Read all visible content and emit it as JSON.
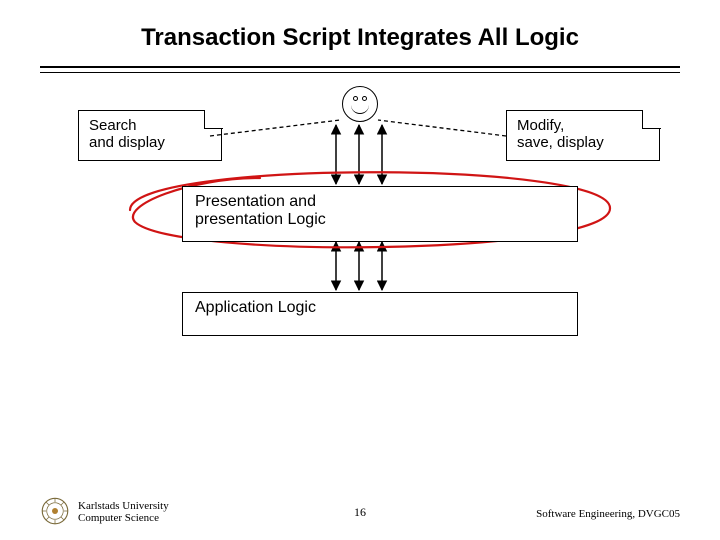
{
  "title": "Transaction Script Integrates All Logic",
  "notes": {
    "left": "Search\nand display",
    "right": "Modify,\nsave, display"
  },
  "layers": {
    "presentation": "Presentation and\npresentation Logic",
    "application": "Application Logic"
  },
  "footer": {
    "org_line1": "Karlstads University",
    "org_line2": "Computer Science",
    "page": "16",
    "course": "Software Engineering, DVGC05"
  },
  "icons": {
    "actor": "smiley-face-icon",
    "seal": "university-seal-icon"
  },
  "colors": {
    "highlight_oval": "#d01414"
  }
}
